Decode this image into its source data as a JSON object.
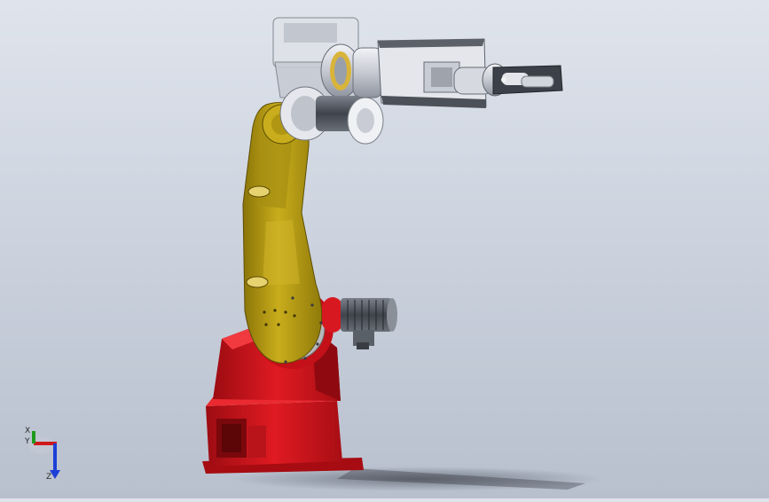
{
  "viewport": {
    "background_top": "#dfe4ec",
    "background_bottom": "#b8c0ce"
  },
  "model": {
    "base_color": "#d4121a",
    "arm_color": "#b49a10",
    "wrist_color": "#c9ccd6",
    "motor_color": "#4a4f58"
  },
  "triad": {
    "x_label": "X",
    "y_label": "Y",
    "z_label": "Z",
    "x_color": "#d01818",
    "y_color": "#1e9a1e",
    "z_color": "#1c3fd6"
  }
}
